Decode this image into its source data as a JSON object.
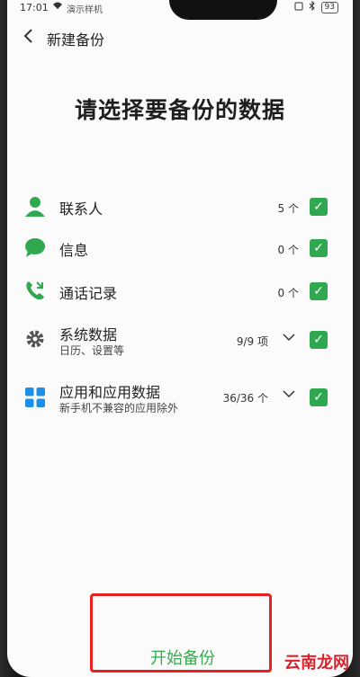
{
  "status_bar": {
    "time": "17:01",
    "carrier": "演示样机",
    "battery": "93"
  },
  "header": {
    "title": "新建备份"
  },
  "page_title": "请选择要备份的数据",
  "items": [
    {
      "label": "联系人",
      "subtitle": "",
      "count": "5 个",
      "icon": "contact-person-icon",
      "expandable": false,
      "checked": true
    },
    {
      "label": "信息",
      "subtitle": "",
      "count": "0 个",
      "icon": "message-bubble-icon",
      "expandable": false,
      "checked": true
    },
    {
      "label": "通话记录",
      "subtitle": "",
      "count": "0 个",
      "icon": "call-log-icon",
      "expandable": false,
      "checked": true
    },
    {
      "label": "系统数据",
      "subtitle": "日历、设置等",
      "count": "9/9 项",
      "icon": "gear-icon",
      "expandable": true,
      "checked": true
    },
    {
      "label": "应用和应用数据",
      "subtitle": "新手机不兼容的应用除外",
      "count": "36/36 个",
      "icon": "apps-grid-icon",
      "expandable": true,
      "checked": true
    }
  ],
  "start_button": "开始备份",
  "watermark": "云南龙网",
  "colors": {
    "accent_green": "#2fa84f",
    "highlight_red": "#e8201f"
  }
}
